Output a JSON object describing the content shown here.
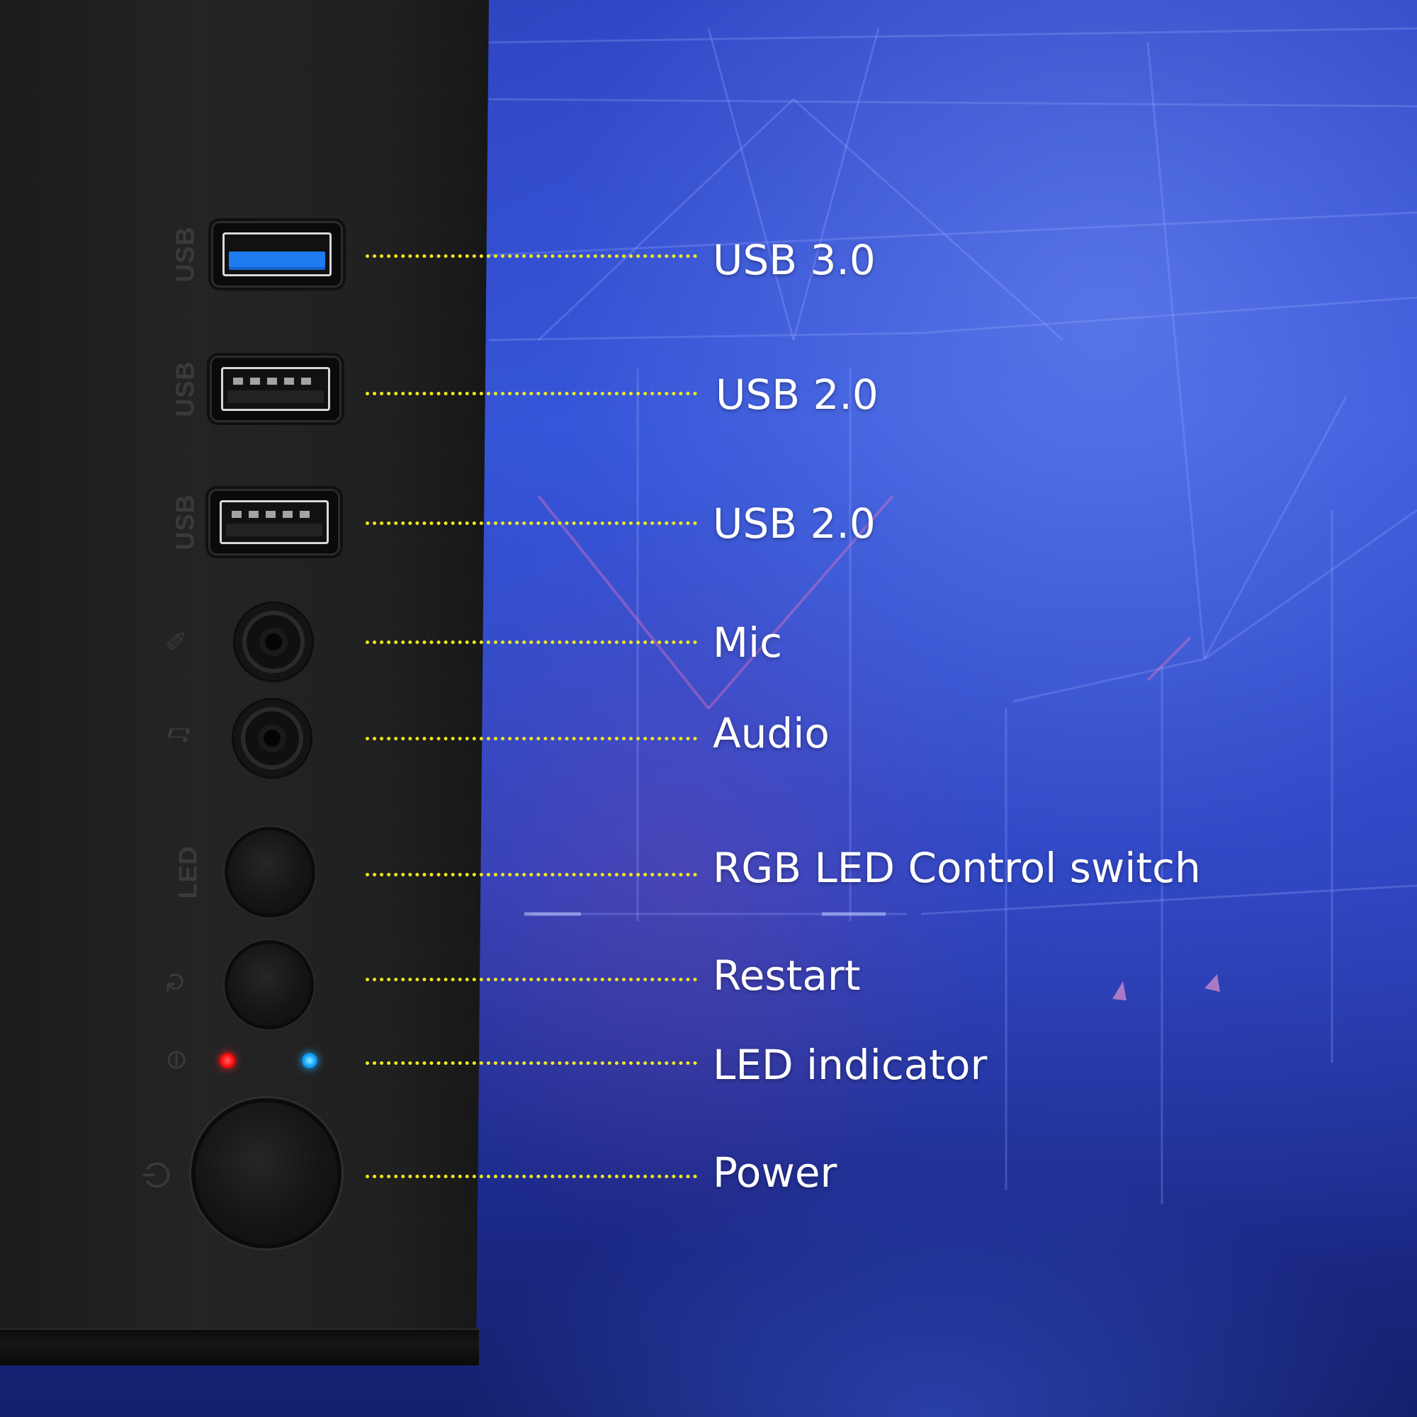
{
  "callouts": {
    "usb3": "USB 3.0",
    "usb2_top": "USB 2.0",
    "usb2_bottom": "USB 2.0",
    "mic": "Mic",
    "audio": "Audio",
    "rgb_switch": "RGB LED Control switch",
    "restart": "Restart",
    "led_indicator": "LED indicator",
    "power": "Power"
  },
  "panel_labels": {
    "usb_a": "USB",
    "usb_b": "USB",
    "usb_c": "USB",
    "led": "LED"
  },
  "colors": {
    "leader_dots": "#f2ea1e",
    "usb3_tongue": "#1f7bf0",
    "led_red": "#ff1010",
    "led_blue": "#15a8ff"
  }
}
